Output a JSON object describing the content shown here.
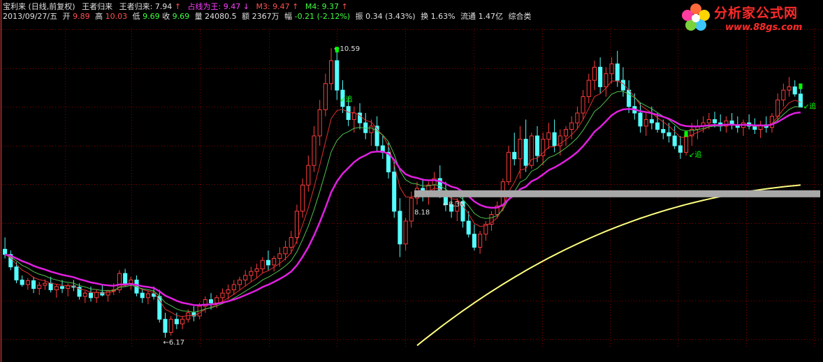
{
  "header": {
    "stock_name": "宝利来",
    "period_label": "(日线,前复权)",
    "ind1_label": "王者归来",
    "ind2_label": "王者归来:",
    "ind2_value": "7.94",
    "ind3_label": "占线为王:",
    "ind3_value": "9.47",
    "m3_label": "M3:",
    "m3_value": "9.47",
    "m4_label": "M4:",
    "m4_value": "9.37",
    "date": "2013/09/27/五",
    "open_label": "开",
    "open": "9.89",
    "high_label": "高",
    "high": "10.03",
    "low_label": "低",
    "low": "9.69",
    "close_label": "收",
    "close": "9.69",
    "vol_label": "量",
    "vol": "24080.5",
    "amount_label": "额",
    "amount": "2367万",
    "change_label": "幅",
    "change": "-0.21 (-2.12%)",
    "amp_label": "振",
    "amp": "0.34 (3.43%)",
    "turnover_label": "换",
    "turnover": "1.63%",
    "float_label": "流通",
    "float": "1.47亿",
    "sector": "综合类"
  },
  "logo": {
    "brand": "分析家公式网",
    "url": "www.88gs.com"
  },
  "colors": {
    "background": "#000000",
    "up": "#ff3c3c",
    "down": "#54ffff",
    "signal": "#00ff00",
    "ma_short": "#e03030",
    "ma_mid": "#50c050",
    "ma_long": "#e020e0",
    "ma_xlong": "#ffff80",
    "grid": "#880000"
  },
  "chart_data": {
    "type": "candlestick",
    "title": "宝利来 (日线,前复权)",
    "price_range": [
      6.0,
      10.9
    ],
    "grid": true,
    "annotations": {
      "high_label": "10.59",
      "low_label": "6.17",
      "mid_low_1": "8.18",
      "mid_low_2": "8.30",
      "buy_signal": "追"
    },
    "buy_signal_indices": [
      58,
      119,
      148
    ],
    "candles": [
      [
        7.52,
        7.7,
        7.38,
        7.44
      ],
      [
        7.44,
        7.5,
        7.2,
        7.25
      ],
      [
        7.25,
        7.32,
        7.0,
        7.05
      ],
      [
        7.05,
        7.12,
        6.95,
        6.98
      ],
      [
        6.98,
        7.08,
        6.9,
        7.04
      ],
      [
        7.04,
        7.1,
        6.85,
        6.92
      ],
      [
        6.92,
        7.02,
        6.82,
        6.97
      ],
      [
        6.97,
        7.06,
        6.9,
        7.0
      ],
      [
        7.0,
        7.1,
        6.86,
        6.9
      ],
      [
        6.9,
        6.99,
        6.78,
        6.95
      ],
      [
        6.95,
        7.05,
        6.85,
        6.92
      ],
      [
        6.92,
        7.0,
        6.8,
        6.96
      ],
      [
        6.96,
        7.05,
        6.88,
        6.94
      ],
      [
        6.94,
        7.0,
        6.75,
        6.8
      ],
      [
        6.8,
        6.88,
        6.7,
        6.85
      ],
      [
        6.85,
        6.95,
        6.72,
        6.78
      ],
      [
        6.78,
        6.9,
        6.7,
        6.86
      ],
      [
        6.86,
        6.98,
        6.8,
        6.82
      ],
      [
        6.82,
        6.9,
        6.72,
        6.88
      ],
      [
        6.88,
        7.0,
        6.82,
        6.9
      ],
      [
        6.9,
        7.2,
        6.85,
        7.15
      ],
      [
        7.15,
        7.22,
        6.95,
        7.0
      ],
      [
        7.0,
        7.1,
        6.9,
        7.05
      ],
      [
        7.05,
        7.12,
        6.8,
        6.85
      ],
      [
        6.85,
        6.92,
        6.7,
        6.78
      ],
      [
        6.78,
        6.88,
        6.68,
        6.84
      ],
      [
        6.84,
        6.95,
        6.75,
        6.8
      ],
      [
        6.8,
        6.9,
        6.4,
        6.45
      ],
      [
        6.45,
        6.55,
        6.17,
        6.25
      ],
      [
        6.25,
        6.5,
        6.2,
        6.45
      ],
      [
        6.45,
        6.55,
        6.3,
        6.38
      ],
      [
        6.38,
        6.5,
        6.3,
        6.45
      ],
      [
        6.45,
        6.6,
        6.4,
        6.55
      ],
      [
        6.55,
        6.65,
        6.42,
        6.5
      ],
      [
        6.5,
        6.7,
        6.45,
        6.65
      ],
      [
        6.65,
        6.8,
        6.55,
        6.75
      ],
      [
        6.75,
        6.85,
        6.6,
        6.7
      ],
      [
        6.7,
        6.82,
        6.62,
        6.78
      ],
      [
        6.78,
        6.92,
        6.7,
        6.85
      ],
      [
        6.85,
        6.98,
        6.75,
        6.9
      ],
      [
        6.9,
        7.05,
        6.82,
        6.98
      ],
      [
        6.98,
        7.1,
        6.9,
        7.05
      ],
      [
        7.05,
        7.2,
        6.95,
        7.12
      ],
      [
        7.12,
        7.25,
        7.02,
        7.18
      ],
      [
        7.18,
        7.3,
        7.08,
        7.22
      ],
      [
        7.22,
        7.4,
        7.15,
        7.35
      ],
      [
        7.35,
        7.5,
        7.2,
        7.28
      ],
      [
        7.28,
        7.42,
        7.18,
        7.38
      ],
      [
        7.38,
        7.55,
        7.25,
        7.45
      ],
      [
        7.45,
        7.65,
        7.35,
        7.55
      ],
      [
        7.55,
        7.8,
        7.45,
        7.7
      ],
      [
        7.7,
        8.2,
        7.6,
        8.1
      ],
      [
        8.1,
        8.6,
        8.0,
        8.5
      ],
      [
        8.5,
        8.95,
        8.4,
        8.8
      ],
      [
        8.8,
        9.4,
        8.7,
        9.25
      ],
      [
        9.25,
        9.8,
        9.1,
        9.65
      ],
      [
        9.65,
        10.2,
        9.55,
        10.05
      ],
      [
        10.05,
        10.59,
        9.95,
        10.4
      ],
      [
        10.4,
        10.59,
        9.8,
        9.95
      ],
      [
        9.95,
        10.1,
        9.6,
        9.7
      ],
      [
        9.7,
        9.85,
        9.4,
        9.5
      ],
      [
        9.5,
        9.7,
        9.3,
        9.6
      ],
      [
        9.6,
        9.75,
        9.35,
        9.45
      ],
      [
        9.45,
        9.6,
        9.2,
        9.3
      ],
      [
        9.3,
        9.5,
        9.1,
        9.4
      ],
      [
        9.4,
        9.55,
        9.0,
        9.1
      ],
      [
        9.1,
        9.25,
        8.9,
        9.0
      ],
      [
        9.0,
        9.15,
        8.6,
        8.7
      ],
      [
        8.7,
        8.85,
        8.0,
        8.1
      ],
      [
        8.1,
        8.3,
        7.4,
        7.6
      ],
      [
        7.6,
        8.0,
        7.5,
        7.95
      ],
      [
        7.95,
        8.4,
        7.85,
        8.3
      ],
      [
        8.3,
        8.55,
        8.2,
        8.45
      ],
      [
        8.45,
        8.6,
        8.25,
        8.35
      ],
      [
        8.35,
        8.55,
        8.2,
        8.5
      ],
      [
        8.5,
        8.7,
        8.4,
        8.6
      ],
      [
        8.6,
        8.8,
        8.3,
        8.4
      ],
      [
        8.4,
        8.55,
        8.1,
        8.2
      ],
      [
        8.2,
        8.35,
        8.0,
        8.1
      ],
      [
        8.1,
        8.3,
        7.95,
        8.25
      ],
      [
        8.25,
        8.4,
        7.85,
        7.95
      ],
      [
        7.95,
        8.1,
        7.7,
        7.75
      ],
      [
        7.75,
        7.9,
        7.5,
        7.55
      ],
      [
        7.55,
        7.8,
        7.45,
        7.75
      ],
      [
        7.75,
        7.95,
        7.65,
        7.9
      ],
      [
        7.9,
        8.1,
        7.8,
        8.05
      ],
      [
        8.05,
        8.25,
        8.0,
        8.18
      ],
      [
        8.18,
        8.6,
        8.1,
        8.55
      ],
      [
        8.55,
        9.1,
        8.5,
        9.0
      ],
      [
        9.0,
        9.3,
        8.8,
        8.9
      ],
      [
        8.9,
        9.4,
        8.6,
        9.2
      ],
      [
        9.2,
        9.5,
        8.7,
        8.8
      ],
      [
        8.8,
        9.3,
        8.75,
        9.25
      ],
      [
        9.25,
        9.4,
        8.85,
        8.95
      ],
      [
        8.95,
        9.3,
        8.8,
        9.2
      ],
      [
        9.2,
        9.45,
        9.05,
        9.3
      ],
      [
        9.3,
        9.5,
        9.0,
        9.1
      ],
      [
        9.1,
        9.35,
        8.95,
        9.25
      ],
      [
        9.25,
        9.4,
        9.1,
        9.35
      ],
      [
        9.35,
        9.55,
        9.2,
        9.45
      ],
      [
        9.45,
        9.7,
        9.35,
        9.6
      ],
      [
        9.6,
        9.95,
        9.5,
        9.85
      ],
      [
        9.85,
        10.2,
        9.75,
        10.1
      ],
      [
        10.1,
        10.4,
        9.95,
        10.3
      ],
      [
        10.3,
        10.45,
        9.9,
        10.0
      ],
      [
        10.0,
        10.3,
        9.85,
        10.2
      ],
      [
        10.2,
        10.45,
        10.05,
        10.35
      ],
      [
        10.35,
        10.55,
        10.0,
        10.1
      ],
      [
        10.1,
        10.3,
        9.85,
        9.95
      ],
      [
        9.95,
        10.1,
        9.6,
        9.7
      ],
      [
        9.7,
        9.9,
        9.5,
        9.6
      ],
      [
        9.6,
        9.75,
        9.3,
        9.4
      ],
      [
        9.4,
        9.6,
        9.25,
        9.5
      ],
      [
        9.5,
        9.7,
        9.35,
        9.45
      ],
      [
        9.45,
        9.6,
        9.3,
        9.35
      ],
      [
        9.35,
        9.5,
        9.2,
        9.3
      ],
      [
        9.3,
        9.45,
        9.15,
        9.25
      ],
      [
        9.25,
        9.4,
        9.05,
        9.1
      ],
      [
        9.1,
        9.25,
        8.9,
        9.0
      ],
      [
        9.0,
        9.3,
        8.95,
        9.25
      ],
      [
        9.25,
        9.45,
        9.1,
        9.35
      ],
      [
        9.35,
        9.5,
        9.2,
        9.4
      ],
      [
        9.4,
        9.55,
        9.3,
        9.45
      ],
      [
        9.45,
        9.6,
        9.35,
        9.5
      ],
      [
        9.5,
        9.62,
        9.38,
        9.45
      ],
      [
        9.45,
        9.58,
        9.32,
        9.4
      ],
      [
        9.4,
        9.55,
        9.3,
        9.48
      ],
      [
        9.48,
        9.6,
        9.35,
        9.42
      ],
      [
        9.42,
        9.55,
        9.3,
        9.38
      ],
      [
        9.38,
        9.5,
        9.25,
        9.45
      ],
      [
        9.45,
        9.58,
        9.35,
        9.4
      ],
      [
        9.4,
        9.52,
        9.28,
        9.35
      ],
      [
        9.35,
        9.48,
        9.22,
        9.42
      ],
      [
        9.42,
        9.55,
        9.3,
        9.38
      ],
      [
        9.38,
        9.6,
        9.3,
        9.55
      ],
      [
        9.55,
        9.9,
        9.45,
        9.8
      ],
      [
        9.8,
        10.05,
        9.7,
        9.95
      ],
      [
        9.95,
        10.15,
        9.85,
        10.0
      ],
      [
        10.0,
        10.1,
        9.85,
        9.89
      ],
      [
        9.89,
        10.03,
        9.69,
        9.69
      ]
    ],
    "series": [
      {
        "name": "M3",
        "values": "computed"
      },
      {
        "name": "M4",
        "values": "computed"
      },
      {
        "name": "占线为王",
        "values": "computed"
      },
      {
        "name": "王者归来",
        "values": "computed"
      }
    ]
  }
}
